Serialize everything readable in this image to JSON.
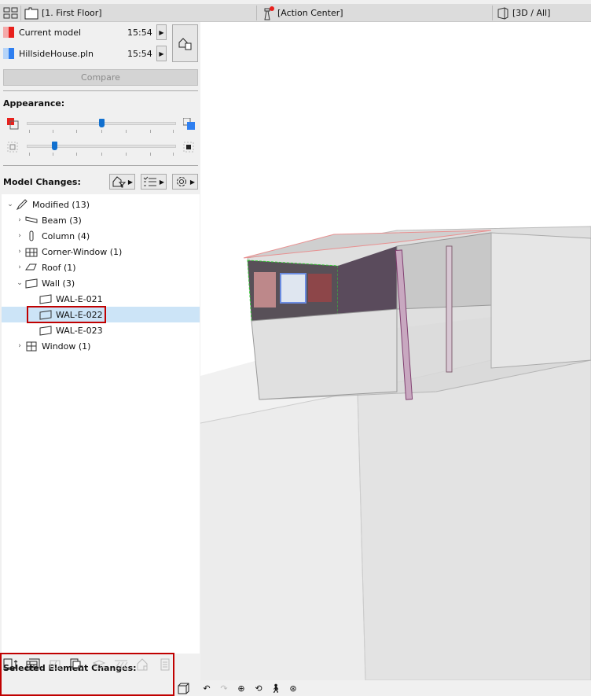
{
  "topbar": {
    "floor_tab": "[1. First Floor]",
    "action_center": "[Action Center]",
    "view_tab": "[3D / All]"
  },
  "compare_panel": {
    "models": [
      {
        "name": "Current model",
        "time": "15:54",
        "color_light": "#f4aaaa",
        "color": "#e8201c"
      },
      {
        "name": "HillsideHouse.pln",
        "time": "15:54",
        "color_light": "#b6d4f8",
        "color": "#2f7ff0"
      }
    ],
    "compare_button": "Compare"
  },
  "appearance": {
    "label": "Appearance:",
    "slider1_value": 0.5,
    "slider2_value": 0.18
  },
  "model_changes": {
    "label": "Model Changes:",
    "tree": [
      {
        "label": "Modified (13)",
        "level": 0,
        "expanded": true,
        "icon": "pencil-icon"
      },
      {
        "label": "Beam (3)",
        "level": 1,
        "expanded": false,
        "icon": "beam-icon"
      },
      {
        "label": "Column (4)",
        "level": 1,
        "expanded": false,
        "icon": "column-icon"
      },
      {
        "label": "Corner-Window (1)",
        "level": 1,
        "expanded": false,
        "icon": "corner-window-icon"
      },
      {
        "label": "Roof (1)",
        "level": 1,
        "expanded": false,
        "icon": "roof-icon"
      },
      {
        "label": "Wall (3)",
        "level": 1,
        "expanded": true,
        "icon": "wall-icon"
      },
      {
        "label": "WAL-E-021",
        "level": 2,
        "icon": "wall-icon"
      },
      {
        "label": "WAL-E-022",
        "level": 2,
        "icon": "wall-icon",
        "selected": true
      },
      {
        "label": "WAL-E-023",
        "level": 2,
        "icon": "wall-icon"
      },
      {
        "label": "Window (1)",
        "level": 1,
        "expanded": false,
        "icon": "window-icon"
      }
    ]
  },
  "selected_changes": {
    "label": "Selected Element Changes:"
  },
  "colors": {
    "accent": "#1170cf",
    "highlight": "#c00000",
    "selection": "#cce4f7"
  }
}
